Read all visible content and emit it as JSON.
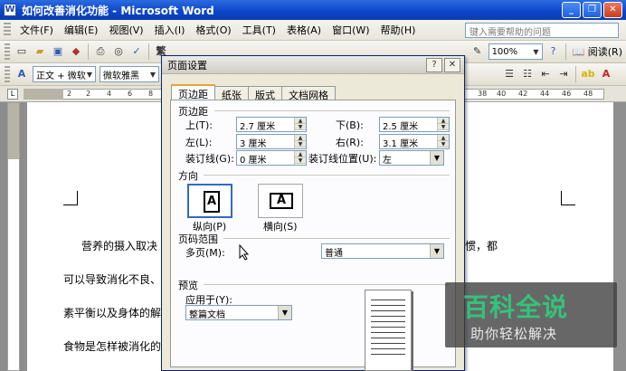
{
  "window": {
    "title": "如何改善消化功能 - Microsoft Word",
    "app_icon": "W"
  },
  "menu": {
    "items": [
      "文件(F)",
      "编辑(E)",
      "视图(V)",
      "插入(I)",
      "格式(O)",
      "工具(T)",
      "表格(A)",
      "窗口(W)",
      "帮助(H)"
    ],
    "help_placeholder": "键入需要帮助的问题"
  },
  "toolbar": {
    "zoom": "100%",
    "read_label": "阅读(R)",
    "trad_char": "繁",
    "style": "正文 + 微软",
    "font": "微软雅黑"
  },
  "ruler": {
    "ticks_left": [
      "2",
      "2",
      "4",
      "6",
      "8"
    ],
    "ticks_right": [
      "38",
      "40",
      "42",
      "44",
      "46",
      "48"
    ]
  },
  "document": {
    "lines": [
      "营养的摄入取决",
      "可以导致消化不良、",
      "素平衡以及身体的解",
      "食物是怎样被消化的"
    ],
    "line_tails": [
      "惯，都",
      ""
    ]
  },
  "dialog": {
    "title": "页面设置",
    "tabs": [
      "页边距",
      "纸张",
      "版式",
      "文档网格"
    ],
    "margins_group": "页边距",
    "top_label": "上(T):",
    "top_value": "2.7 厘米",
    "bottom_label": "下(B):",
    "bottom_value": "2.5 厘米",
    "left_label": "左(L):",
    "left_value": "3 厘米",
    "right_label": "右(R):",
    "right_value": "3.1 厘米",
    "gutter_label": "装订线(G):",
    "gutter_value": "0 厘米",
    "gutter_pos_label": "装订线位置(U):",
    "gutter_pos_value": "左",
    "orientation_group": "方向",
    "portrait_label": "纵向(P)",
    "landscape_label": "横向(S)",
    "portrait_glyph": "A",
    "landscape_glyph": "A",
    "pages_group": "页码范围",
    "multi_pages_label": "多页(M):",
    "multi_pages_value": "普通",
    "preview_group": "预览",
    "apply_to_label": "应用于(Y):",
    "apply_to_value": "整篇文档"
  },
  "watermark": {
    "main": "百科全说",
    "sub": "助你轻松解决"
  }
}
